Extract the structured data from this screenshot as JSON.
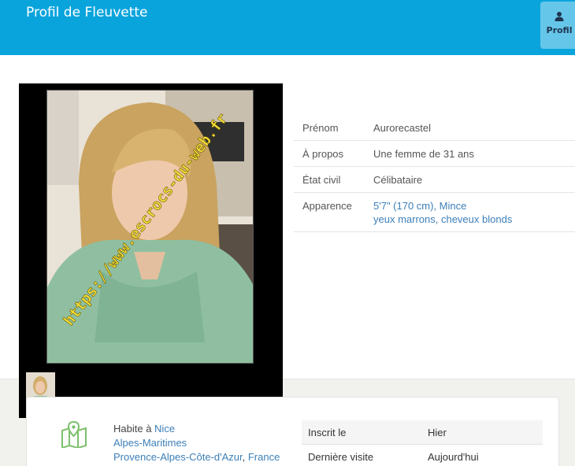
{
  "header": {
    "title": "Profil de Fleuvette",
    "tab_label": "Profil",
    "tab_icon": "user-icon",
    "bg_color": "#0aa4dd"
  },
  "photo": {
    "watermark": "https://www.escrocs-du-web.fr"
  },
  "details": [
    {
      "label": "Prénom",
      "value": "Aurorecastel"
    },
    {
      "label": "À propos",
      "value": "Une femme de 31 ans"
    },
    {
      "label": "État civil",
      "value": "Célibataire"
    },
    {
      "label": "Apparence",
      "value_line1": "5'7\" (170 cm), Mince",
      "value_line2": "yeux marrons, cheveux blonds"
    }
  ],
  "location": {
    "icon": "map-icon",
    "prefix": "Habite à ",
    "city": "Nice",
    "department": "Alpes-Maritimes",
    "region": "Provence-Alpes-Côte-d'Azur",
    "separator": ", ",
    "country": "France"
  },
  "meta": [
    {
      "label": "Inscrit le",
      "value": "Hier"
    },
    {
      "label": "Dernière visite",
      "value": "Aujourd'hui"
    }
  ],
  "colors": {
    "link": "#3d7fb8",
    "accent": "#0aa4dd",
    "map_icon": "#7cc06d"
  }
}
